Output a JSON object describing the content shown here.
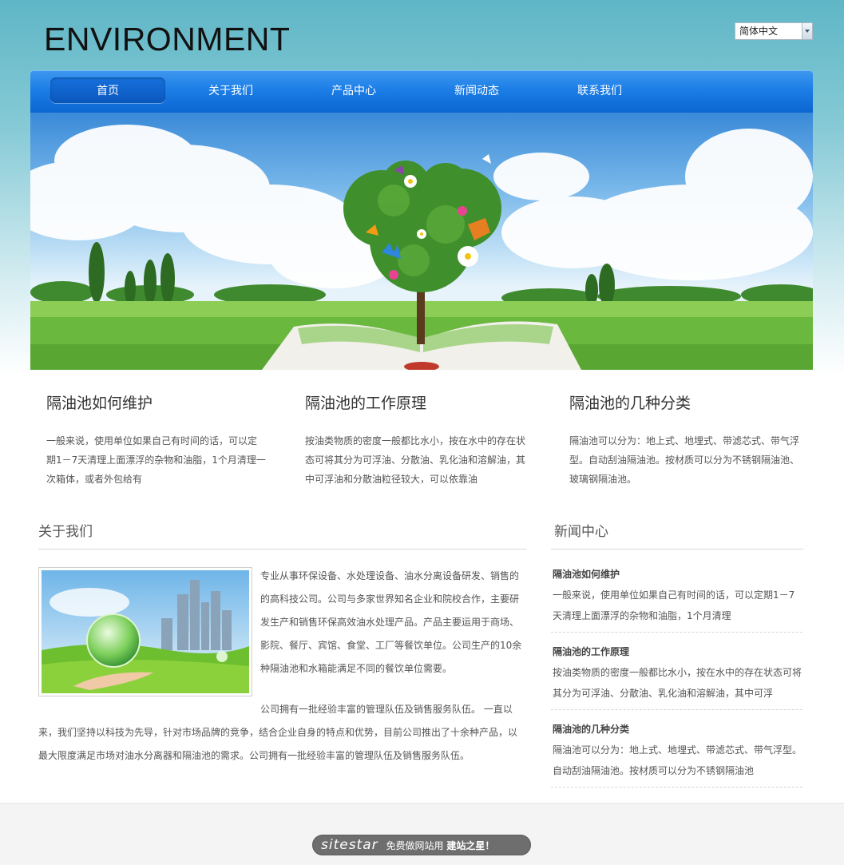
{
  "header": {
    "logo": "ENVIRONMENT",
    "language": "简体中文"
  },
  "nav": {
    "items": [
      "首页",
      "关于我们",
      "产品中心",
      "新闻动态",
      "联系我们"
    ],
    "active_index": 0
  },
  "features": [
    {
      "title": "隔油池如何维护",
      "text": "一般来说，使用单位如果自己有时间的话，可以定期1－7天清理上面漂浮的杂物和油脂，1个月清理一次箱体，或者外包给有"
    },
    {
      "title": "隔油池的工作原理",
      "text": "按油类物质的密度一般都比水小，按在水中的存在状态可将其分为可浮油、分散油、乳化油和溶解油，其中可浮油和分散油粒径较大，可以依靠油"
    },
    {
      "title": "隔油池的几种分类",
      "text": "隔油池可以分为：地上式、地埋式、带滤芯式、带气浮型。自动刮油隔油池。按材质可以分为不锈钢隔油池、玻璃钢隔油池。"
    }
  ],
  "about": {
    "title": "关于我们",
    "p1": "专业从事环保设备、水处理设备、油水分离设备研发、销售的的高科技公司。公司与多家世界知名企业和院校合作，主要研发生产和销售环保高效油水处理产品。产品主要运用于商场、影院、餐厅、宾馆、食堂、工厂等餐饮单位。公司生产的10余种隔油池和水箱能满足不同的餐饮单位需要。",
    "p2": "公司拥有一批经验丰富的管理队伍及销售服务队伍。 一直以来，我们坚持以科技为先导，针对市场品牌的竞争，结合企业自身的特点和优势，目前公司推出了十余种产品，以最大限度满足市场对油水分离器和隔油池的需求。公司拥有一批经验丰富的管理队伍及销售服务队伍。"
  },
  "news": {
    "title": "新闻中心",
    "items": [
      {
        "title": "隔油池如何维护",
        "text": "一般来说，使用单位如果自己有时间的话，可以定期1－7天清理上面漂浮的杂物和油脂，1个月清理"
      },
      {
        "title": "隔油池的工作原理",
        "text": "按油类物质的密度一般都比水小，按在水中的存在状态可将其分为可浮油、分散油、乳化油和溶解油，其中可浮"
      },
      {
        "title": "隔油池的几种分类",
        "text": "隔油池可以分为：地上式、地埋式、带滤芯式、带气浮型。自动刮油隔油池。按材质可以分为不锈钢隔油池"
      }
    ]
  },
  "footer": {
    "brand": "sitestar",
    "text": "免费做网站用",
    "bold": "建站之星！"
  },
  "colors": {
    "nav_blue": "#1c7ee6",
    "bg_teal": "#5fb6c6"
  }
}
